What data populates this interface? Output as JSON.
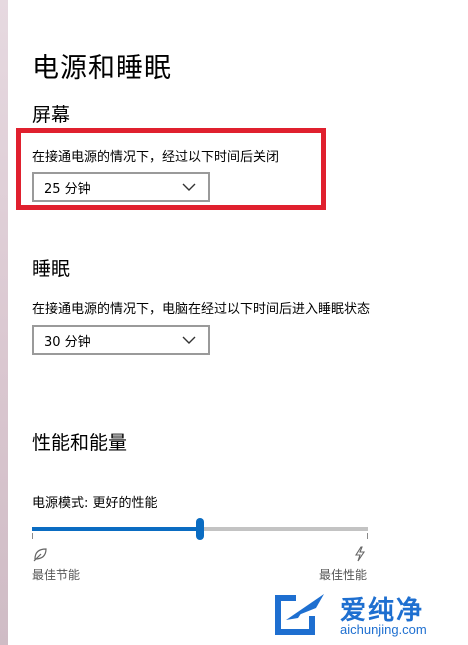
{
  "page": {
    "title": "电源和睡眠"
  },
  "screen": {
    "heading": "屏幕",
    "description": "在接通电源的情况下，经过以下时间后关闭",
    "selected_value": "25 分钟"
  },
  "sleep": {
    "heading": "睡眠",
    "description": "在接通电源的情况下，电脑在经过以下时间后进入睡眠状态",
    "selected_value": "30 分钟"
  },
  "performance": {
    "heading": "性能和能量",
    "mode_label": "电源模式: 更好的性能",
    "slider_level_fraction": 0.5,
    "left_label": "最佳节能",
    "right_label": "最佳性能",
    "left_icon": "leaf-icon",
    "right_icon": "lightning-icon"
  },
  "watermark": {
    "title": "爱纯净",
    "url": "aichunjing.com"
  },
  "colors": {
    "accent": "#0a6cc2",
    "highlight": "#e0202e",
    "watermark": "#1e6fd0"
  }
}
